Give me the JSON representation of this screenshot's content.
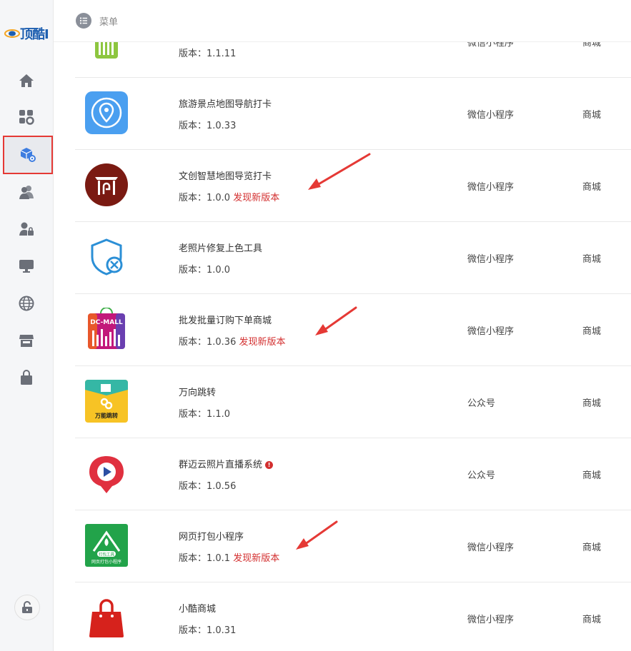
{
  "brand": {
    "logo_text": "顶酷I"
  },
  "header": {
    "menu_label": "菜单"
  },
  "sidebar": {
    "items": [
      {
        "icon": "home-icon"
      },
      {
        "icon": "apps-settings-icon"
      },
      {
        "icon": "package-settings-icon",
        "active": true
      },
      {
        "icon": "users-icon"
      },
      {
        "icon": "user-lock-icon"
      },
      {
        "icon": "monitor-icon"
      },
      {
        "icon": "globe-icon"
      },
      {
        "icon": "store-icon"
      },
      {
        "icon": "shopping-bag-icon"
      }
    ],
    "bottom_icon": "lock-icon"
  },
  "apps": [
    {
      "name": "",
      "version": "版本：1.1.11",
      "new_version": "",
      "type": "微信小程序",
      "category": "商城",
      "icon": "green-gate-icon"
    },
    {
      "name": "旅游景点地图导航打卡",
      "version": "版本：1.0.33",
      "new_version": "",
      "type": "微信小程序",
      "category": "商城",
      "icon": "map-pin-icon"
    },
    {
      "name": "文创智慧地图导览打卡",
      "version": "版本：1.0.0",
      "new_version": "发现新版本",
      "type": "微信小程序",
      "category": "商城",
      "icon": "cultural-gate-icon"
    },
    {
      "name": "老照片修复上色工具",
      "version": "版本：1.0.0",
      "new_version": "",
      "type": "微信小程序",
      "category": "商城",
      "icon": "shield-tools-icon"
    },
    {
      "name": "批发批量订购下单商城",
      "version": "版本：1.0.36",
      "new_version": "发现新版本",
      "type": "微信小程序",
      "category": "商城",
      "icon": "dc-mall-icon",
      "icon_text": "DC-MALL"
    },
    {
      "name": "万向跳转",
      "version": "版本：1.1.0",
      "new_version": "",
      "type": "公众号",
      "category": "商城",
      "icon": "link-jump-icon",
      "icon_text": "万能跳转"
    },
    {
      "name": "群迈云照片直播系统",
      "version": "版本：1.0.56",
      "new_version": "",
      "type": "公众号",
      "category": "商城",
      "icon": "photo-live-icon",
      "info_badge": "!"
    },
    {
      "name": "网页打包小程序",
      "version": "版本：1.0.1",
      "new_version": "发现新版本",
      "type": "微信小程序",
      "category": "商城",
      "icon": "web-pack-icon",
      "icon_text": "打包工具",
      "icon_subtext": "网页打包小程序"
    },
    {
      "name": "小酷商城",
      "version": "版本：1.0.31",
      "new_version": "",
      "type": "微信小程序",
      "category": "商城",
      "icon": "red-bag-icon"
    }
  ],
  "colors": {
    "accent_red": "#d32f2f",
    "sidebar_bg": "#f5f6f8",
    "active_border": "#e53935"
  }
}
